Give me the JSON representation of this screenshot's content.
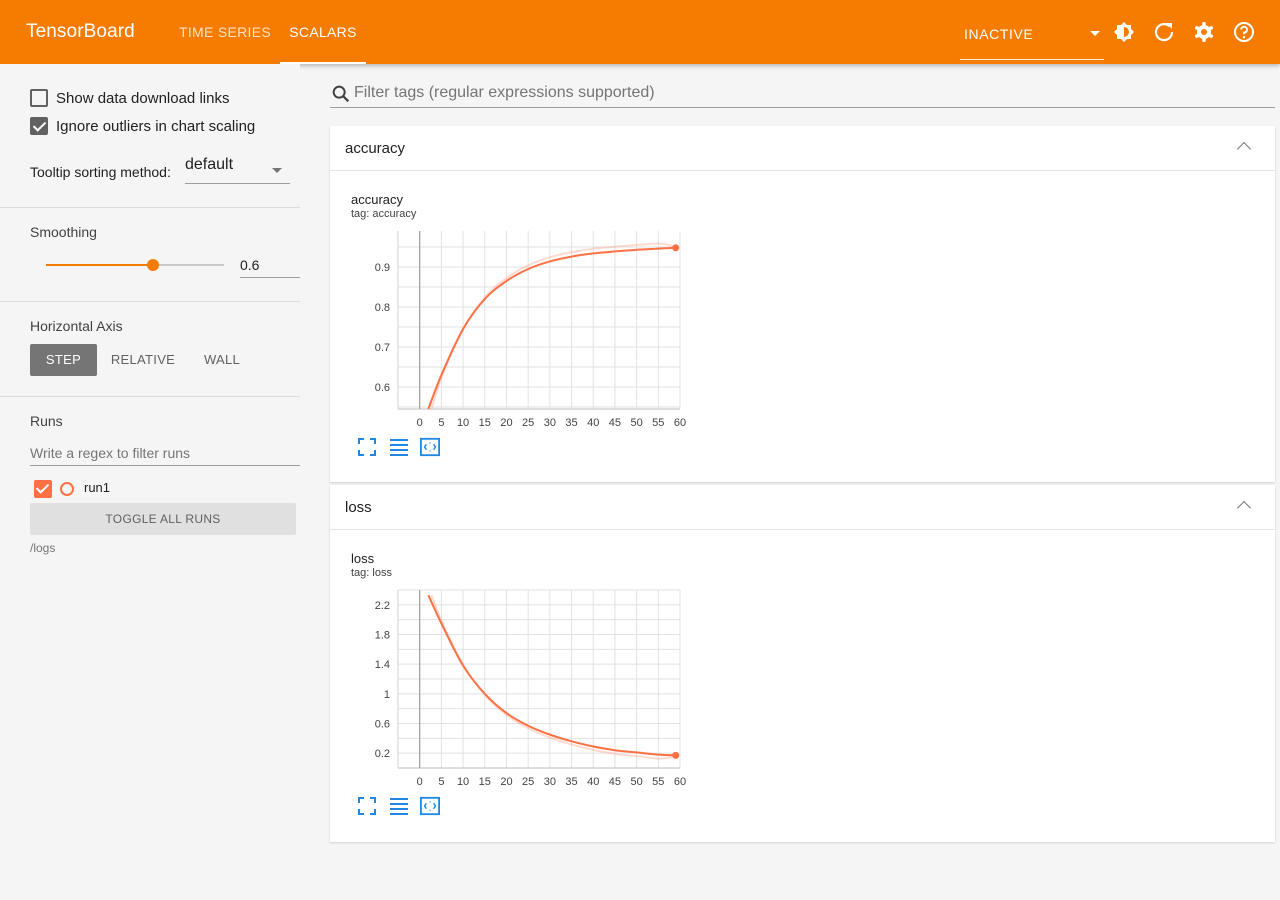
{
  "header": {
    "brand": "TensorBoard",
    "tabs": [
      {
        "label": "TIME SERIES",
        "active": false
      },
      {
        "label": "SCALARS",
        "active": true
      }
    ],
    "status_select": "INACTIVE",
    "icons": [
      "theme-icon",
      "reload-icon",
      "settings-icon",
      "help-icon"
    ]
  },
  "sidebar": {
    "show_download_links": {
      "label": "Show data download links",
      "checked": false
    },
    "ignore_outliers": {
      "label": "Ignore outliers in chart scaling",
      "checked": true
    },
    "tooltip_sorting": {
      "label": "Tooltip sorting method:",
      "value": "default"
    },
    "smoothing": {
      "title": "Smoothing",
      "value": "0.6",
      "fraction": 0.6
    },
    "horizontal_axis": {
      "title": "Horizontal Axis",
      "options": [
        "STEP",
        "RELATIVE",
        "WALL"
      ],
      "selected": "STEP"
    },
    "runs": {
      "title": "Runs",
      "filter_placeholder": "Write a regex to filter runs",
      "items": [
        {
          "name": "run1",
          "checked": true,
          "color": "#ff7043"
        }
      ],
      "toggle_label": "TOGGLE ALL RUNS",
      "logdir": "/logs"
    }
  },
  "main": {
    "filter_placeholder": "Filter tags (regular expressions supported)",
    "cards": [
      {
        "header": "accuracy",
        "chart_title": "accuracy",
        "chart_tag": "tag: accuracy"
      },
      {
        "header": "loss",
        "chart_title": "loss",
        "chart_tag": "tag: loss"
      }
    ]
  },
  "colors": {
    "accent": "#f57c00",
    "run1": "#ff7043"
  },
  "chart_data": [
    {
      "type": "line",
      "title": "accuracy",
      "subtitle": "tag: accuracy",
      "xlabel": "",
      "ylabel": "",
      "xlim": [
        -5,
        60
      ],
      "ylim": [
        0.545,
        0.99
      ],
      "xticks": [
        "0",
        "5",
        "10",
        "15",
        "20",
        "25",
        "30",
        "35",
        "40",
        "45",
        "50",
        "55",
        "60"
      ],
      "yticks": [
        "0.6",
        "0.7",
        "0.8",
        "0.9"
      ],
      "grid": true,
      "series": [
        {
          "name": "run1",
          "x": [
            2,
            5,
            10,
            15,
            20,
            25,
            30,
            35,
            40,
            45,
            50,
            55,
            59
          ],
          "y": [
            0.545,
            0.63,
            0.745,
            0.82,
            0.865,
            0.895,
            0.914,
            0.926,
            0.934,
            0.939,
            0.943,
            0.946,
            0.948
          ]
        }
      ]
    },
    {
      "type": "line",
      "title": "loss",
      "subtitle": "tag: loss",
      "xlabel": "",
      "ylabel": "",
      "xlim": [
        -5,
        60
      ],
      "ylim": [
        0,
        2.4
      ],
      "xticks": [
        "0",
        "5",
        "10",
        "15",
        "20",
        "25",
        "30",
        "35",
        "40",
        "45",
        "50",
        "55",
        "60"
      ],
      "yticks": [
        "0.2",
        "0.6",
        "1",
        "1.4",
        "1.8",
        "2.2"
      ],
      "grid": true,
      "series": [
        {
          "name": "run1",
          "x": [
            2,
            5,
            10,
            15,
            20,
            25,
            30,
            35,
            40,
            45,
            50,
            55,
            59
          ],
          "y": [
            2.33,
            1.95,
            1.38,
            1.0,
            0.74,
            0.57,
            0.45,
            0.36,
            0.29,
            0.24,
            0.21,
            0.18,
            0.17
          ]
        }
      ]
    }
  ]
}
